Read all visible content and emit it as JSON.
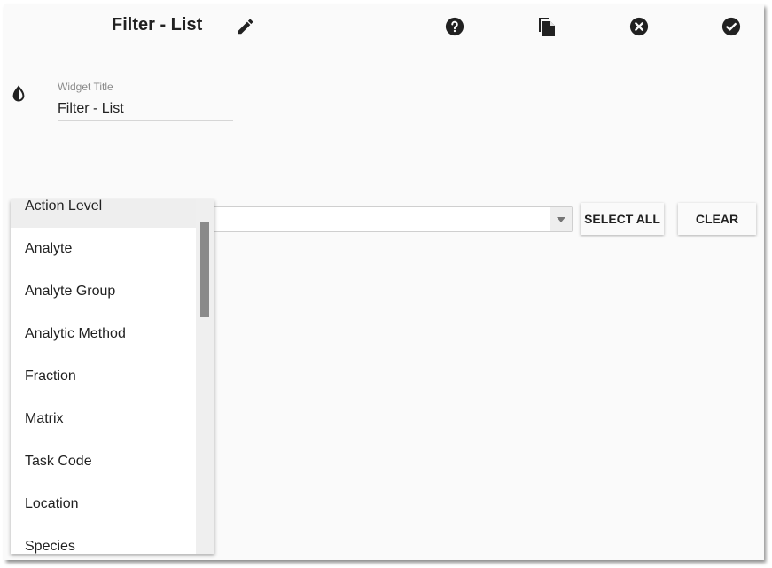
{
  "header": {
    "title": "Filter - List",
    "icons": {
      "edit": "pencil-icon",
      "help": "help-circle-icon",
      "copy": "copy-icon",
      "cancel": "close-circle-icon",
      "confirm": "check-circle-icon"
    }
  },
  "settings": {
    "theme_icon": "invert-colors-icon",
    "widget_title_label": "Widget Title",
    "widget_title_value": "Filter - List"
  },
  "filter": {
    "select_value": "",
    "select_all_label": "SELECT ALL",
    "clear_label": "CLEAR",
    "dropdown_items": [
      "Action Level",
      "Analyte",
      "Analyte Group",
      "Analytic Method",
      "Fraction",
      "Matrix",
      "Task Code",
      "Location",
      "Species"
    ],
    "highlighted_item": "Action Level"
  }
}
